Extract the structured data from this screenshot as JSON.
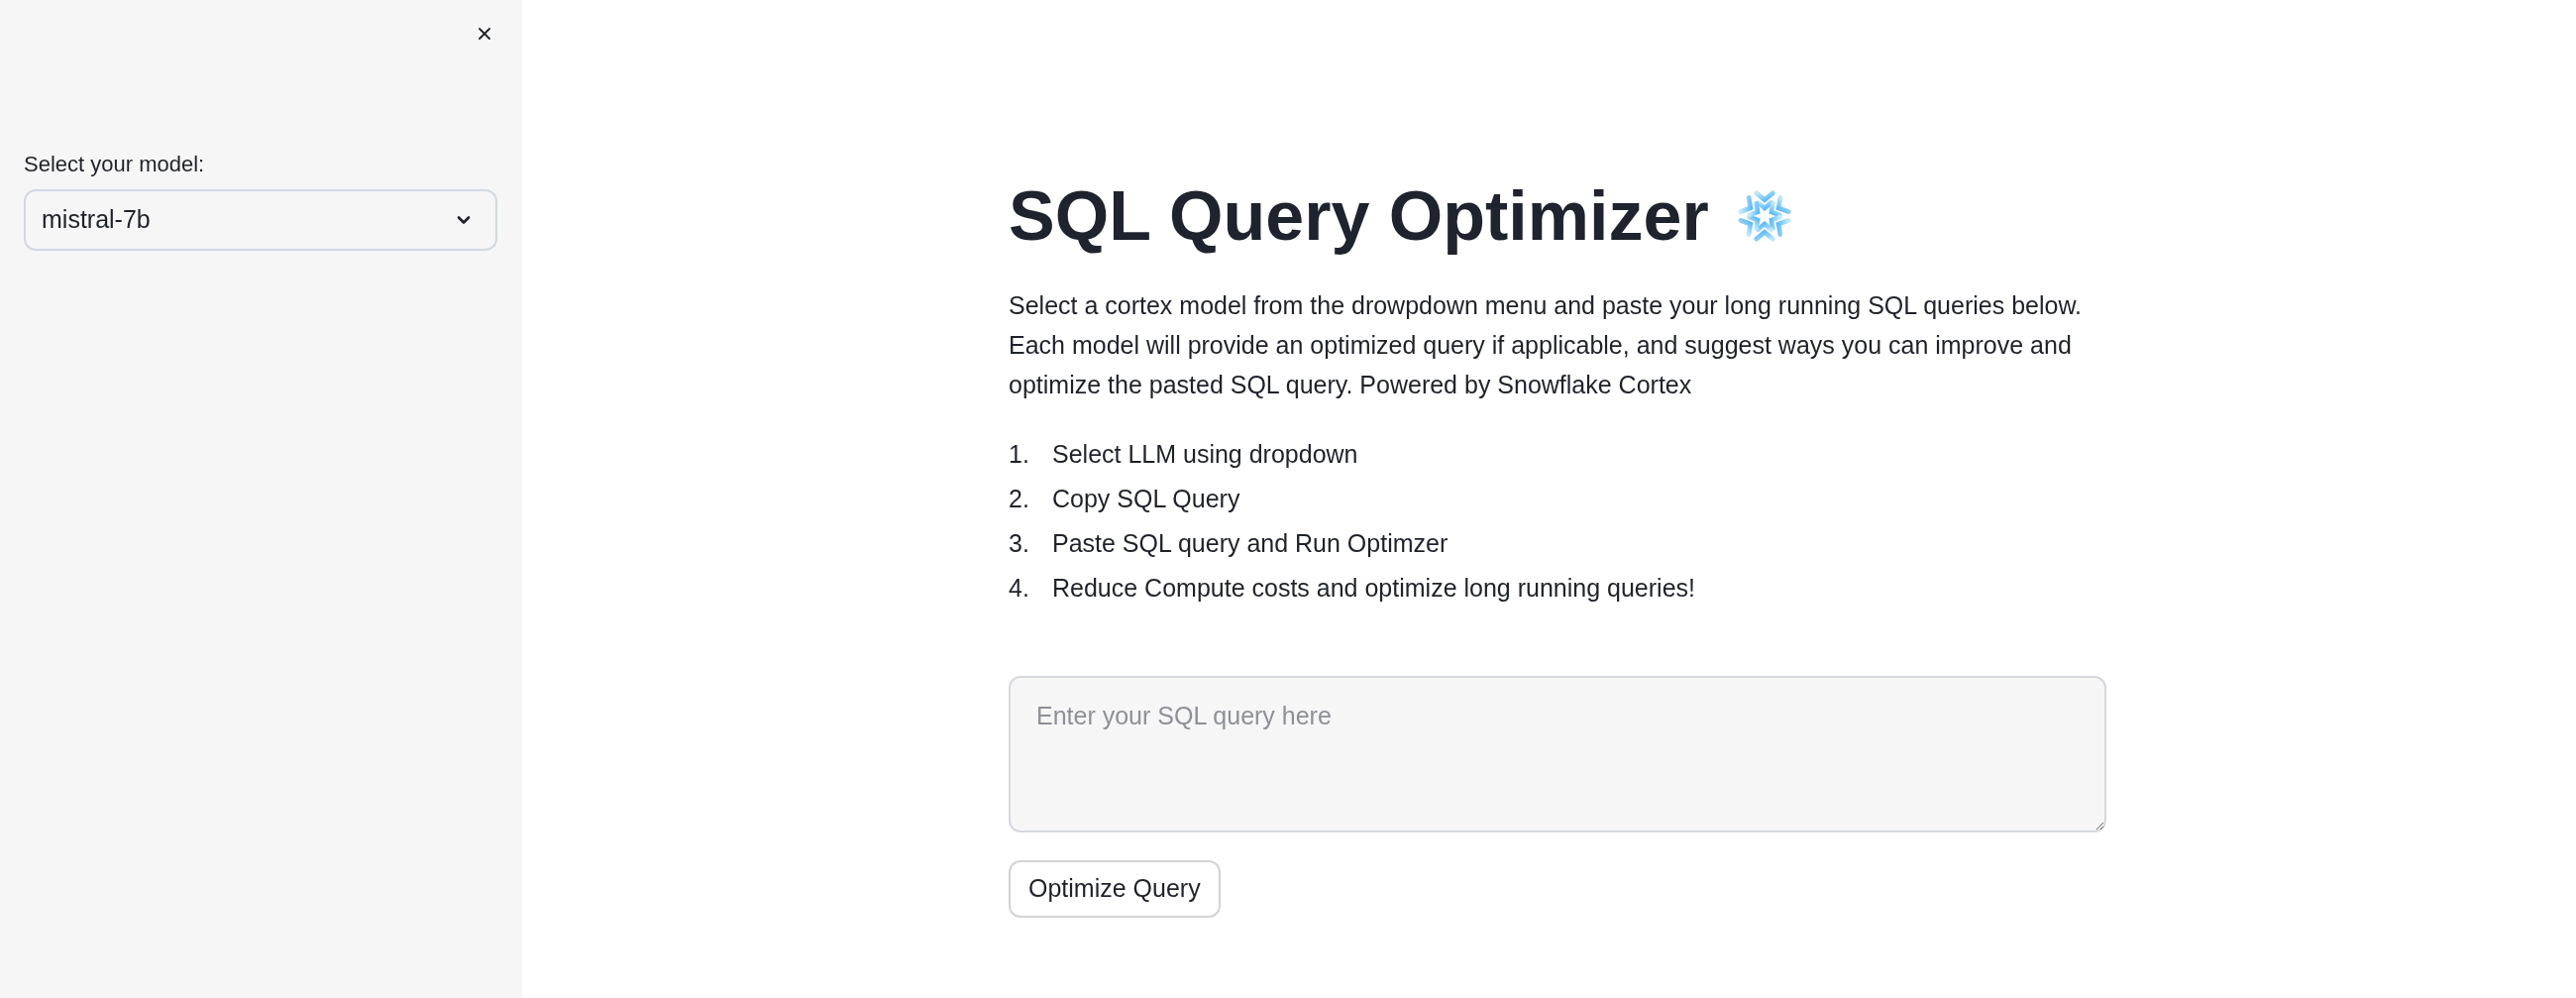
{
  "sidebar": {
    "model_select": {
      "label": "Select your model:",
      "value": "mistral-7b"
    }
  },
  "main": {
    "title": "SQL Query Optimizer",
    "description": "Select a cortex model from the drowpdown menu and paste your long running SQL queries below. Each model will provide an optimized query if applicable, and suggest ways you can improve and optimize the pasted SQL query. Powered by Snowflake Cortex",
    "steps": [
      {
        "number": "1.",
        "text": "Select LLM using dropdown"
      },
      {
        "number": "2.",
        "text": "Copy SQL Query"
      },
      {
        "number": "3.",
        "text": "Paste SQL query and Run Optimzer"
      },
      {
        "number": "4.",
        "text": "Reduce Compute costs and optimize long running queries!"
      }
    ],
    "query_field": {
      "placeholder": "Enter your SQL query here"
    },
    "submit_button": "Optimize Query"
  }
}
